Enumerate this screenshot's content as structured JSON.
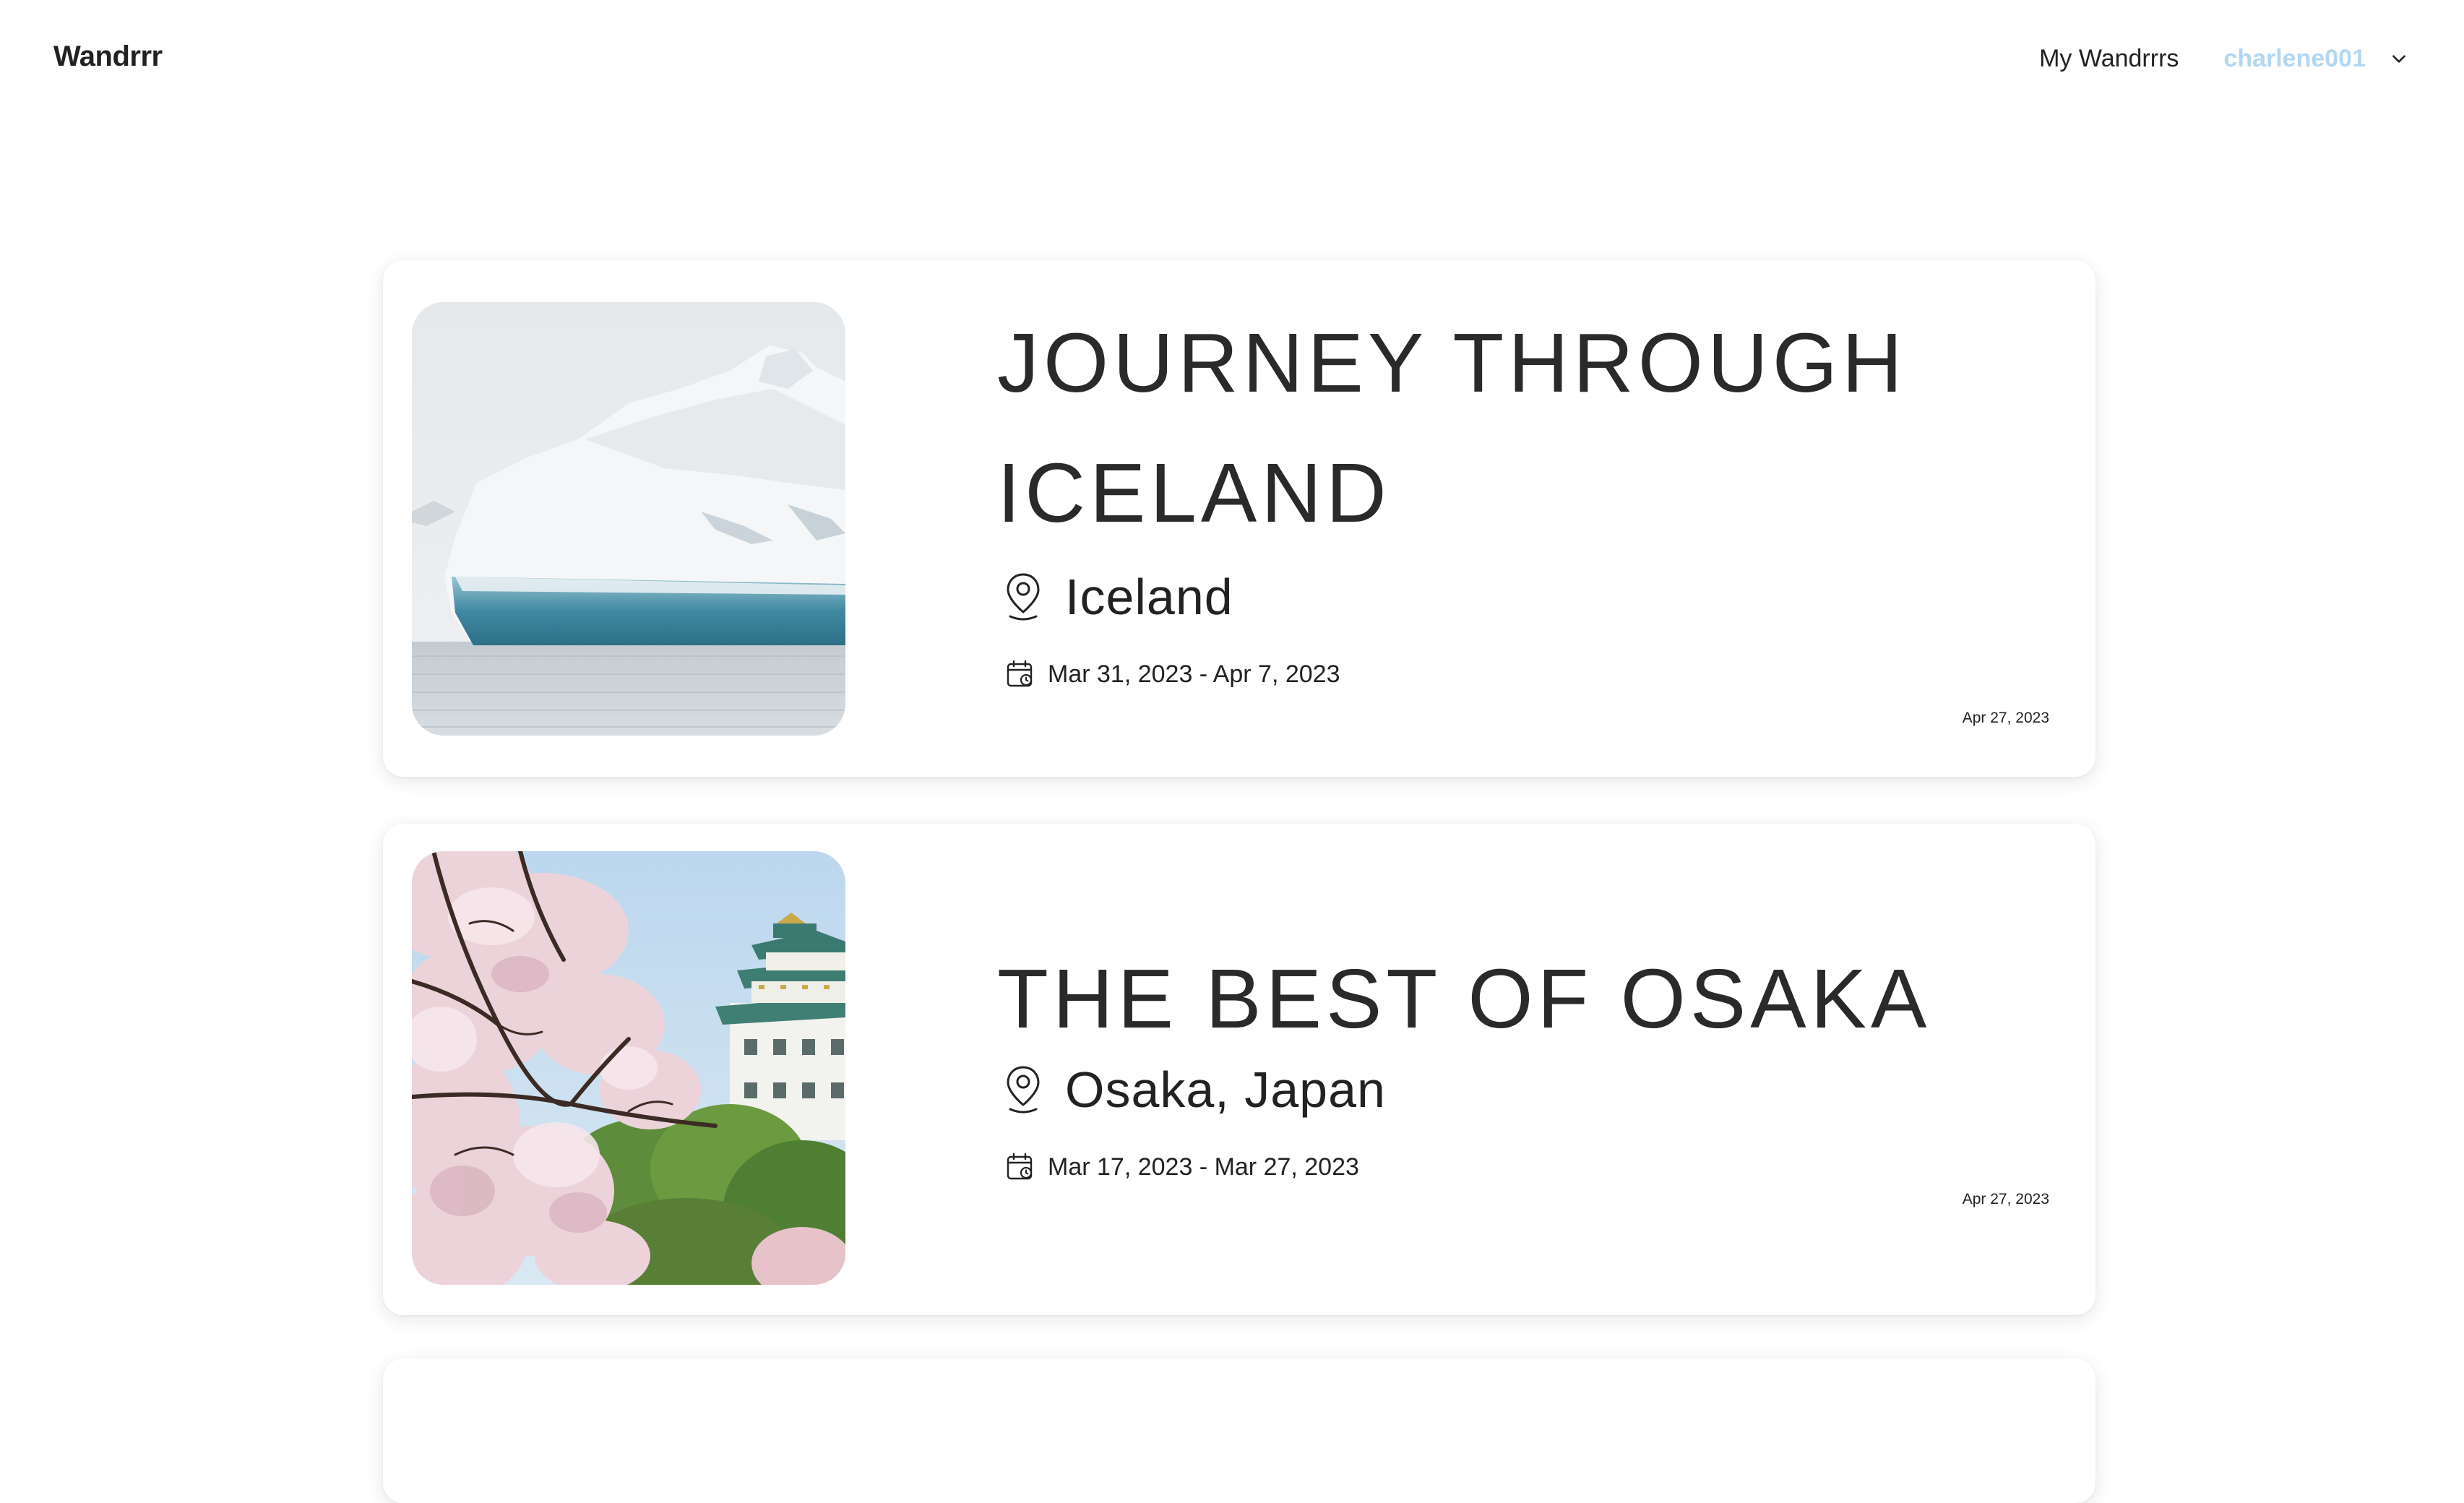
{
  "header": {
    "brand": "Wandrrr",
    "nav_link": "My Wandrrrs",
    "username": "charlene001",
    "user_color": "#b3d7f2"
  },
  "trips": [
    {
      "title_line1": "JOURNEY THROUGH",
      "title_line2": "ICELAND",
      "location": "Iceland",
      "dates": "Mar 31, 2023 - Apr 7, 2023",
      "posted": "Apr 27, 2023",
      "image": "iceberg"
    },
    {
      "title_line1": "THE BEST OF OSAKA",
      "location": "Osaka, Japan",
      "dates": "Mar 17, 2023 - Mar 27, 2023",
      "posted": "Apr 27, 2023",
      "image": "osaka-castle-cherry-blossoms"
    }
  ],
  "icons": {
    "location": "map-pin-icon",
    "dates": "calendar-icon",
    "menu": "chevron-down-icon"
  }
}
